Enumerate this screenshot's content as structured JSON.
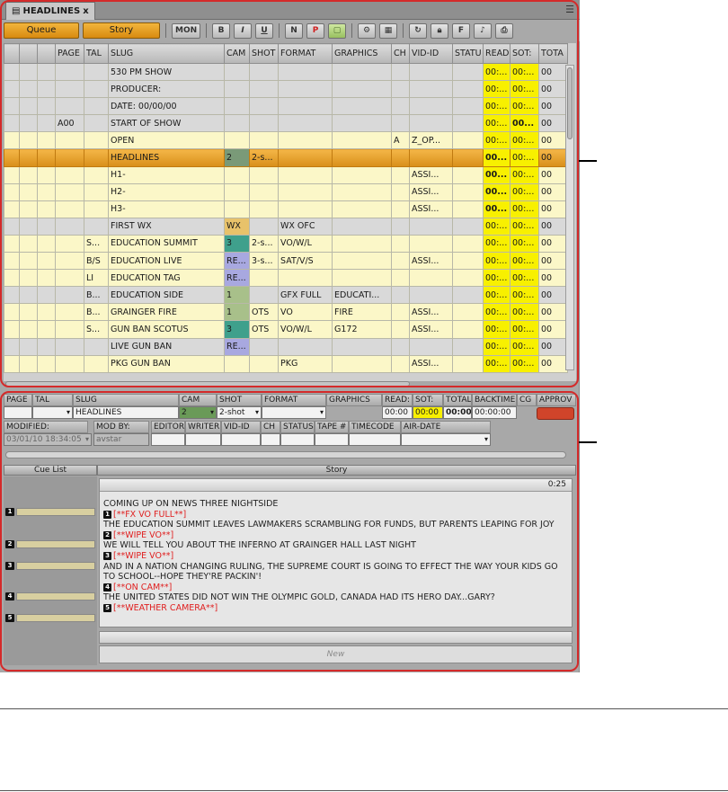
{
  "tab": {
    "title": "HEADLINES",
    "close": "x"
  },
  "toolbar": {
    "queue": "Queue",
    "story": "Story",
    "mon": "MON",
    "bold": "B",
    "italic": "I",
    "underline": "U",
    "n": "N",
    "p": "P",
    "f": "F"
  },
  "grid": {
    "headers": [
      "",
      "",
      "",
      "PAGE",
      "TAL",
      "SLUG",
      "CAM",
      "SHOT",
      "FORMAT",
      "GRAPHICS",
      "CH",
      "VID-ID",
      "STATU",
      "READ",
      "SOT:",
      "TOTA"
    ],
    "rows": [
      {
        "style": "grey",
        "page": "",
        "tal": "",
        "slug": "530 PM SHOW",
        "cam": "",
        "camStyle": "",
        "shot": "",
        "format": "",
        "graphics": "",
        "ch": "",
        "vid": "",
        "status": "",
        "read": "00:...",
        "readBold": false,
        "sot": "00:...",
        "sotBold": false,
        "total": "00"
      },
      {
        "style": "grey",
        "page": "",
        "tal": "",
        "slug": "PRODUCER:",
        "cam": "",
        "camStyle": "",
        "shot": "",
        "format": "",
        "graphics": "",
        "ch": "",
        "vid": "",
        "status": "",
        "read": "00:...",
        "readBold": false,
        "sot": "00:...",
        "sotBold": false,
        "total": "00"
      },
      {
        "style": "grey",
        "page": "",
        "tal": "",
        "slug": "DATE: 00/00/00",
        "cam": "",
        "camStyle": "",
        "shot": "",
        "format": "",
        "graphics": "",
        "ch": "",
        "vid": "",
        "status": "",
        "read": "00:...",
        "readBold": false,
        "sot": "00:...",
        "sotBold": false,
        "total": "00"
      },
      {
        "style": "grey",
        "page": "A00",
        "tal": "",
        "slug": "START OF SHOW",
        "cam": "",
        "camStyle": "",
        "shot": "",
        "format": "",
        "graphics": "",
        "ch": "",
        "vid": "",
        "status": "",
        "read": "00:...",
        "readBold": false,
        "sot": "00...",
        "sotBold": true,
        "total": "00"
      },
      {
        "style": "yel",
        "page": "",
        "tal": "",
        "slug": "OPEN",
        "cam": "",
        "camStyle": "",
        "shot": "",
        "format": "",
        "graphics": "",
        "ch": "A",
        "vid": "Z_OP...",
        "status": "",
        "read": "00:...",
        "readBold": false,
        "sot": "00:...",
        "sotBold": false,
        "total": "00"
      },
      {
        "style": "sel",
        "page": "",
        "tal": "",
        "slug": "HEADLINES",
        "cam": "2",
        "camStyle": "cam2",
        "shot": "2-s...",
        "format": "",
        "graphics": "",
        "ch": "",
        "vid": "",
        "status": "",
        "read": "00...",
        "readBold": true,
        "sot": "00:...",
        "sotBold": false,
        "total": "00"
      },
      {
        "style": "yel",
        "page": "",
        "tal": "",
        "slug": "H1-",
        "cam": "",
        "camStyle": "",
        "shot": "",
        "format": "",
        "graphics": "",
        "ch": "",
        "vid": "ASSI...",
        "status": "",
        "read": "00...",
        "readBold": true,
        "sot": "00:...",
        "sotBold": false,
        "total": "00"
      },
      {
        "style": "yel",
        "page": "",
        "tal": "",
        "slug": "H2-",
        "cam": "",
        "camStyle": "",
        "shot": "",
        "format": "",
        "graphics": "",
        "ch": "",
        "vid": "ASSI...",
        "status": "",
        "read": "00...",
        "readBold": true,
        "sot": "00:...",
        "sotBold": false,
        "total": "00"
      },
      {
        "style": "yel",
        "page": "",
        "tal": "",
        "slug": "H3-",
        "cam": "",
        "camStyle": "",
        "shot": "",
        "format": "",
        "graphics": "",
        "ch": "",
        "vid": "ASSI...",
        "status": "",
        "read": "00...",
        "readBold": true,
        "sot": "00:...",
        "sotBold": false,
        "total": "00"
      },
      {
        "style": "grey",
        "page": "",
        "tal": "",
        "slug": "FIRST WX",
        "cam": "WX",
        "camStyle": "camwx",
        "shot": "",
        "format": "WX OFC",
        "graphics": "",
        "ch": "",
        "vid": "",
        "status": "",
        "read": "00:...",
        "readBold": false,
        "sot": "00:...",
        "sotBold": false,
        "total": "00"
      },
      {
        "style": "yel",
        "page": "",
        "tal": "S...",
        "slug": "EDUCATION SUMMIT",
        "cam": "3",
        "camStyle": "cam3",
        "shot": "2-s...",
        "format": "VO/W/L",
        "graphics": "",
        "ch": "",
        "vid": "",
        "status": "",
        "read": "00:...",
        "readBold": false,
        "sot": "00:...",
        "sotBold": false,
        "total": "00"
      },
      {
        "style": "yel",
        "page": "",
        "tal": "B/S",
        "slug": "EDUCATION LIVE",
        "cam": "RE...",
        "camStyle": "camre",
        "shot": "3-s...",
        "format": "SAT/V/S",
        "graphics": "",
        "ch": "",
        "vid": "ASSI...",
        "status": "",
        "read": "00:...",
        "readBold": false,
        "sot": "00:...",
        "sotBold": false,
        "total": "00"
      },
      {
        "style": "yel",
        "page": "",
        "tal": "LI",
        "slug": "EDUCATION TAG",
        "cam": "RE...",
        "camStyle": "camre",
        "shot": "",
        "format": "",
        "graphics": "",
        "ch": "",
        "vid": "",
        "status": "",
        "read": "00:...",
        "readBold": false,
        "sot": "00:...",
        "sotBold": false,
        "total": "00"
      },
      {
        "style": "grey",
        "page": "",
        "tal": "B...",
        "slug": "EDUCATION SIDE",
        "cam": "1",
        "camStyle": "cam1",
        "shot": "",
        "format": "GFX FULL",
        "graphics": "EDUCATI...",
        "ch": "",
        "vid": "",
        "status": "",
        "read": "00:...",
        "readBold": false,
        "sot": "00:...",
        "sotBold": false,
        "total": "00"
      },
      {
        "style": "yel",
        "page": "",
        "tal": "B...",
        "slug": "GRAINGER FIRE",
        "cam": "1",
        "camStyle": "cam1",
        "shot": "OTS",
        "format": "VO",
        "graphics": "FIRE",
        "ch": "",
        "vid": "ASSI...",
        "status": "",
        "read": "00:...",
        "readBold": false,
        "sot": "00:...",
        "sotBold": false,
        "total": "00"
      },
      {
        "style": "yel",
        "page": "",
        "tal": "S...",
        "slug": "GUN BAN SCOTUS",
        "cam": "3",
        "camStyle": "cam3",
        "shot": "OTS",
        "format": "VO/W/L",
        "graphics": "G172",
        "ch": "",
        "vid": "ASSI...",
        "status": "",
        "read": "00:...",
        "readBold": false,
        "sot": "00:...",
        "sotBold": false,
        "total": "00"
      },
      {
        "style": "grey",
        "page": "",
        "tal": "",
        "slug": "LIVE GUN BAN",
        "cam": "RE...",
        "camStyle": "camre",
        "shot": "",
        "format": "",
        "graphics": "",
        "ch": "",
        "vid": "",
        "status": "",
        "read": "00:...",
        "readBold": false,
        "sot": "00:...",
        "sotBold": false,
        "total": "00"
      },
      {
        "style": "yel",
        "page": "",
        "tal": "",
        "slug": "PKG GUN BAN",
        "cam": "",
        "camStyle": "",
        "shot": "",
        "format": "PKG",
        "graphics": "",
        "ch": "",
        "vid": "ASSI...",
        "status": "",
        "read": "00:...",
        "readBold": false,
        "sot": "00:...",
        "sotBold": false,
        "total": "00"
      }
    ]
  },
  "detail": {
    "row1_labels": {
      "page": "PAGE",
      "tal": "TAL",
      "slug": "SLUG",
      "cam": "CAM",
      "shot": "SHOT",
      "format": "FORMAT",
      "graphics": "GRAPHICS",
      "read": "READ:",
      "sot": "SOT:",
      "total": "TOTAL",
      "backtime": "BACKTIME",
      "cg": "CG",
      "approved": "APPROV"
    },
    "row1_values": {
      "slug": "HEADLINES",
      "cam": "2",
      "shot": "2-shot",
      "read": "00:00",
      "sot": "00:00",
      "total": "00:00",
      "backtime": "00:00:00"
    },
    "row2_labels": {
      "modified": "MODIFIED:",
      "mod_by": "MOD BY:",
      "editor": "EDITOR",
      "writer": "WRITER",
      "vid_id": "VID-ID",
      "ch": "CH",
      "status": "STATUS",
      "tape": "TAPE #",
      "timecode": "TIMECODE",
      "air_date": "AIR-DATE"
    },
    "row2_values": {
      "modified": "03/01/10 18:34:05",
      "mod_by": "avstar"
    }
  },
  "cue_list": {
    "title": "Cue List",
    "items": [
      "1",
      "2",
      "3",
      "4",
      "5"
    ]
  },
  "story": {
    "title": "Story",
    "timer": "0:25",
    "lines": [
      {
        "type": "text",
        "text": "COMING UP ON NEWS THREE NIGHTSIDE"
      },
      {
        "type": "cmd",
        "num": "1",
        "text": "[**FX VO FULL**]"
      },
      {
        "type": "text",
        "text": "THE EDUCATION SUMMIT LEAVES LAWMAKERS SCRAMBLING FOR FUNDS, BUT PARENTS LEAPING FOR JOY"
      },
      {
        "type": "cmd",
        "num": "2",
        "text": "[**WIPE VO**]"
      },
      {
        "type": "text",
        "text": "WE WILL TELL YOU ABOUT THE INFERNO AT GRAINGER HALL LAST NIGHT"
      },
      {
        "type": "cmd",
        "num": "3",
        "text": "[**WIPE VO**]"
      },
      {
        "type": "text",
        "text": "AND IN A NATION CHANGING RULING, THE SUPREME COURT IS GOING TO EFFECT THE WAY YOUR KIDS GO TO SCHOOL--HOPE THEY'RE PACKIN'!"
      },
      {
        "type": "cmd",
        "num": "4",
        "text": "[**ON CAM**]"
      },
      {
        "type": "text",
        "text": "THE UNITED STATES DID NOT WIN THE OLYMPIC GOLD, CANADA HAD ITS HERO DAY...GARY?"
      },
      {
        "type": "cmd",
        "num": "5",
        "text": "[**WEATHER CAMERA**]"
      }
    ],
    "new_label": "New"
  },
  "colors": {
    "highlight_frame": "#d42a2a",
    "selected_row": "#e29a26",
    "read_col": "#f8f000",
    "cue_red": "#e02020"
  }
}
